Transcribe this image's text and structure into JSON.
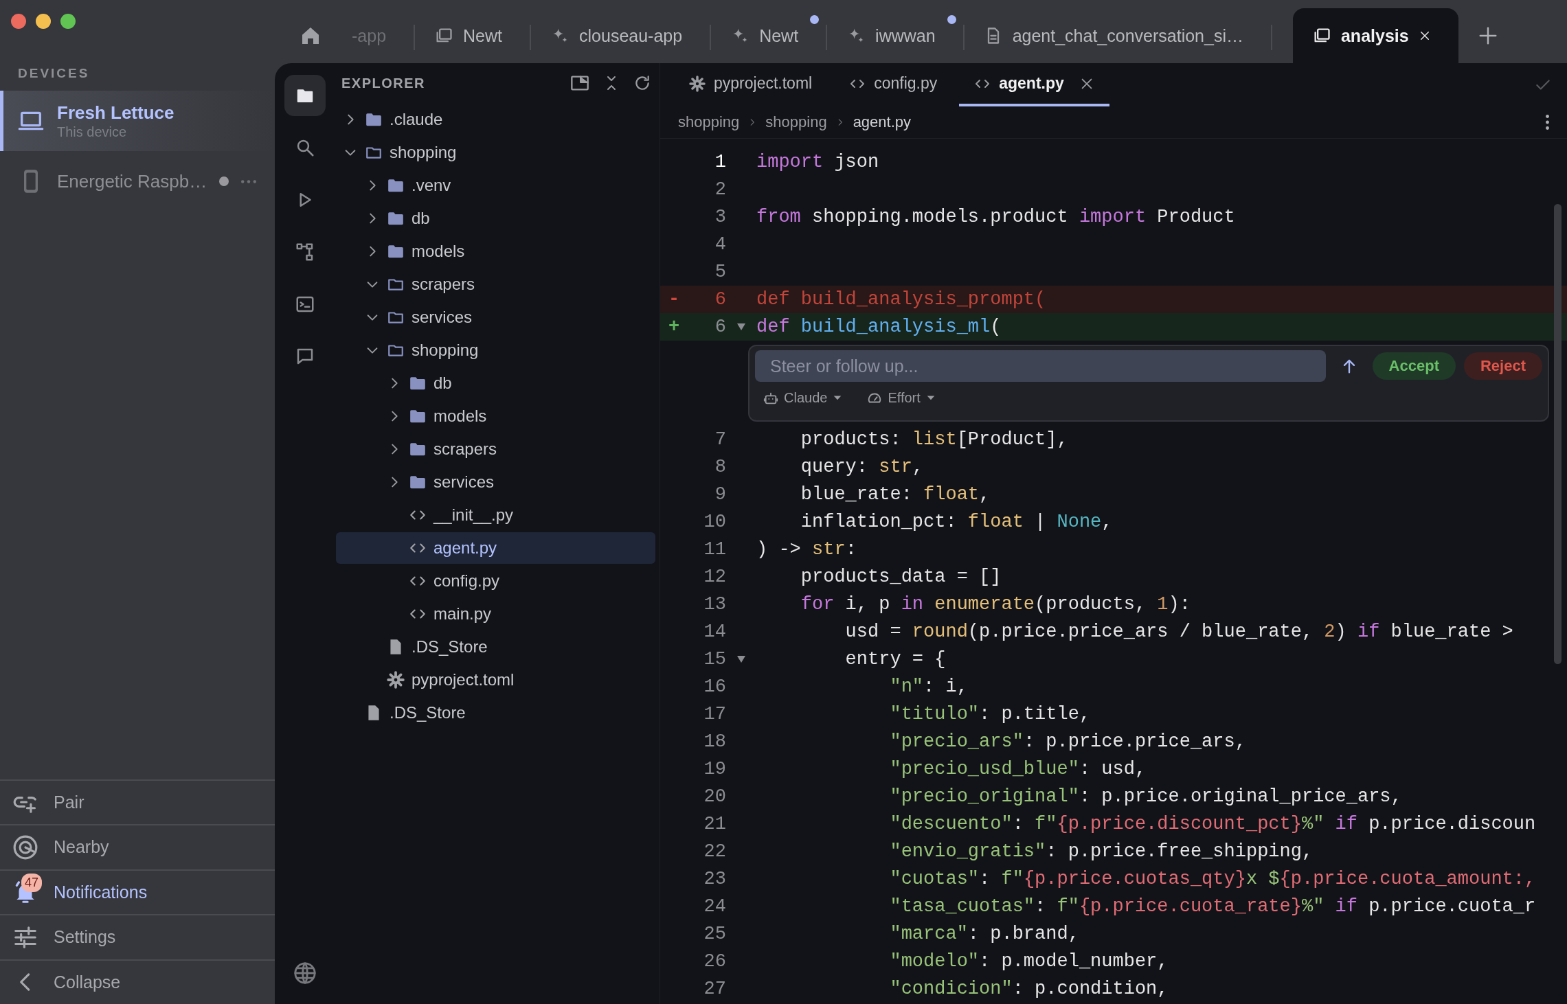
{
  "sidebar": {
    "heading": "DEVICES",
    "devices": [
      {
        "name": "Fresh Lettuce",
        "subtitle": "This device",
        "kind": "laptop",
        "selected": true,
        "status_dot": false
      },
      {
        "name": "Energetic Raspb…",
        "kind": "phone",
        "selected": false,
        "status_dot": true
      }
    ],
    "nav": [
      {
        "label": "Pair",
        "kind": "pair",
        "selected": false
      },
      {
        "label": "Nearby",
        "kind": "nearby",
        "selected": false
      },
      {
        "label": "Notifications",
        "kind": "bell",
        "selected": true,
        "badge": "47"
      },
      {
        "label": "Settings",
        "kind": "settings",
        "selected": false
      },
      {
        "label": "Collapse",
        "kind": "collapse",
        "selected": false
      }
    ]
  },
  "top_tabs": [
    {
      "label": "-app",
      "kind": "clipped",
      "selected": false,
      "unread": false
    },
    {
      "label": "Newt",
      "kind": "folders",
      "selected": false,
      "unread": false
    },
    {
      "label": "clouseau-app",
      "kind": "sparkle",
      "selected": false,
      "unread": false
    },
    {
      "label": "Newt",
      "kind": "sparkle",
      "selected": false,
      "unread": true
    },
    {
      "label": "iwwwan",
      "kind": "sparkle",
      "selected": false,
      "unread": true
    },
    {
      "label": "agent_chat_conversation_si…",
      "kind": "doc",
      "selected": false,
      "unread": false
    },
    {
      "label": "analysis",
      "kind": "folders",
      "selected": true,
      "unread": false
    }
  ],
  "activity_bar": [
    {
      "kind": "files",
      "selected": true
    },
    {
      "kind": "search",
      "selected": false
    },
    {
      "kind": "run",
      "selected": false
    },
    {
      "kind": "diagram",
      "selected": false
    },
    {
      "kind": "terminal",
      "selected": false
    },
    {
      "kind": "chat",
      "selected": false
    }
  ],
  "explorer": {
    "title": "EXPLORER",
    "tree": [
      {
        "name": ".claude",
        "kind": "folder",
        "expanded": false,
        "selected": false
      },
      {
        "name": "shopping",
        "kind": "folder",
        "expanded": true,
        "selected": false,
        "children": [
          {
            "name": ".venv",
            "kind": "folder",
            "expanded": false,
            "selected": false
          },
          {
            "name": "db",
            "kind": "folder",
            "expanded": false,
            "selected": false
          },
          {
            "name": "models",
            "kind": "folder",
            "expanded": false,
            "selected": false
          },
          {
            "name": "scrapers",
            "kind": "folder",
            "expanded": true,
            "selected": false
          },
          {
            "name": "services",
            "kind": "folder",
            "expanded": true,
            "selected": false
          },
          {
            "name": "shopping",
            "kind": "folder",
            "expanded": true,
            "selected": false,
            "children": [
              {
                "name": "db",
                "kind": "folder",
                "expanded": false,
                "selected": false
              },
              {
                "name": "models",
                "kind": "folder",
                "expanded": false,
                "selected": false
              },
              {
                "name": "scrapers",
                "kind": "folder",
                "expanded": false,
                "selected": false
              },
              {
                "name": "services",
                "kind": "folder",
                "expanded": false,
                "selected": false
              },
              {
                "name": "__init__.py",
                "kind": "code",
                "selected": false
              },
              {
                "name": "agent.py",
                "kind": "code",
                "selected": true
              },
              {
                "name": "config.py",
                "kind": "code",
                "selected": false
              },
              {
                "name": "main.py",
                "kind": "code",
                "selected": false
              }
            ]
          },
          {
            "name": ".DS_Store",
            "kind": "file",
            "selected": false
          },
          {
            "name": "pyproject.toml",
            "kind": "config",
            "selected": false
          }
        ]
      },
      {
        "name": ".DS_Store",
        "kind": "file",
        "selected": false
      }
    ]
  },
  "editor": {
    "tabs": [
      {
        "label": "pyproject.toml",
        "kind": "config",
        "selected": false
      },
      {
        "label": "config.py",
        "kind": "code",
        "selected": false
      },
      {
        "label": "agent.py",
        "kind": "code",
        "selected": true
      }
    ],
    "breadcrumb": [
      "shopping",
      "shopping",
      "agent.py"
    ],
    "lines_before": [
      {
        "n": "1",
        "kind": "context",
        "current": true,
        "fold": false,
        "tokens": [
          {
            "kind": "keyword",
            "text": "import"
          },
          {
            "kind": "plain",
            "text": " json"
          }
        ]
      },
      {
        "n": "2",
        "kind": "context",
        "current": false,
        "fold": false
      },
      {
        "n": "3",
        "kind": "context",
        "current": false,
        "fold": false,
        "tokens": [
          {
            "kind": "keyword",
            "text": "from"
          },
          {
            "kind": "plain",
            "text": " shopping.models.product "
          },
          {
            "kind": "keyword",
            "text": "import"
          },
          {
            "kind": "plain",
            "text": " Product"
          }
        ]
      },
      {
        "n": "4",
        "kind": "context",
        "current": false,
        "fold": false
      },
      {
        "n": "5",
        "kind": "context",
        "current": false,
        "fold": false
      },
      {
        "n": "6",
        "kind": "removed",
        "sign": "-",
        "current": false,
        "fold": false,
        "tokens": [
          {
            "kind": "keyword",
            "text": "def"
          },
          {
            "kind": "plain",
            "text": " build_analysis_prompt("
          }
        ]
      },
      {
        "n": "6",
        "kind": "added",
        "sign": "+",
        "current": false,
        "fold": true,
        "tokens": [
          {
            "kind": "keyword",
            "text": "def "
          },
          {
            "kind": "function",
            "text": "build_analysis_ml"
          },
          {
            "kind": "plain",
            "text": "("
          }
        ]
      }
    ],
    "inline_prompt": {
      "placeholder": "Steer or follow up...",
      "buttons": [
        {
          "label": "Accept",
          "kind": "accept"
        },
        {
          "label": "Reject",
          "kind": "reject"
        }
      ],
      "model": "Claude",
      "effort": "Effort"
    },
    "lines_after": [
      {
        "n": "7",
        "kind": "context",
        "current": false,
        "fold": false,
        "tokens": [
          {
            "kind": "plain",
            "text": "    products: "
          },
          {
            "kind": "type",
            "text": "list"
          },
          {
            "kind": "plain",
            "text": "[Product],"
          }
        ]
      },
      {
        "n": "8",
        "kind": "context",
        "current": false,
        "fold": false,
        "tokens": [
          {
            "kind": "plain",
            "text": "    query: "
          },
          {
            "kind": "type",
            "text": "str"
          },
          {
            "kind": "plain",
            "text": ","
          }
        ]
      },
      {
        "n": "9",
        "kind": "context",
        "current": false,
        "fold": false,
        "tokens": [
          {
            "kind": "plain",
            "text": "    blue_rate: "
          },
          {
            "kind": "type",
            "text": "float"
          },
          {
            "kind": "plain",
            "text": ","
          }
        ]
      },
      {
        "n": "10",
        "kind": "context",
        "current": false,
        "fold": false,
        "tokens": [
          {
            "kind": "plain",
            "text": "    inflation_pct: "
          },
          {
            "kind": "type",
            "text": "float"
          },
          {
            "kind": "plain",
            "text": " | "
          },
          {
            "kind": "constant",
            "text": "None"
          },
          {
            "kind": "plain",
            "text": ","
          }
        ]
      },
      {
        "n": "11",
        "kind": "context",
        "current": false,
        "fold": false,
        "tokens": [
          {
            "kind": "plain",
            "text": ") -> "
          },
          {
            "kind": "type",
            "text": "str"
          },
          {
            "kind": "plain",
            "text": ":"
          }
        ]
      },
      {
        "n": "12",
        "kind": "context",
        "current": false,
        "fold": false,
        "tokens": [
          {
            "kind": "plain",
            "text": "    products_data = []"
          }
        ]
      },
      {
        "n": "13",
        "kind": "context",
        "current": false,
        "fold": false,
        "tokens": [
          {
            "kind": "keyword",
            "text": "    for"
          },
          {
            "kind": "plain",
            "text": " i, p "
          },
          {
            "kind": "keyword",
            "text": "in "
          },
          {
            "kind": "type",
            "text": "enumerate"
          },
          {
            "kind": "plain",
            "text": "(products, "
          },
          {
            "kind": "number",
            "text": "1"
          },
          {
            "kind": "plain",
            "text": "):"
          }
        ]
      },
      {
        "n": "14",
        "kind": "context",
        "current": false,
        "fold": false,
        "tokens": [
          {
            "kind": "plain",
            "text": "        usd = "
          },
          {
            "kind": "type",
            "text": "round"
          },
          {
            "kind": "plain",
            "text": "(p.price.price_ars / blue_rate, "
          },
          {
            "kind": "number",
            "text": "2"
          },
          {
            "kind": "plain",
            "text": ") "
          },
          {
            "kind": "keyword",
            "text": "if"
          },
          {
            "kind": "plain",
            "text": " blue_rate >"
          }
        ]
      },
      {
        "n": "15",
        "kind": "context",
        "current": false,
        "fold": true,
        "tokens": [
          {
            "kind": "plain",
            "text": "        entry = {"
          }
        ]
      },
      {
        "n": "16",
        "kind": "context",
        "current": false,
        "fold": false,
        "tokens": [
          {
            "kind": "string",
            "text": "            \"n\""
          },
          {
            "kind": "plain",
            "text": ": i,"
          }
        ]
      },
      {
        "n": "17",
        "kind": "context",
        "current": false,
        "fold": false,
        "tokens": [
          {
            "kind": "string",
            "text": "            \"titulo\""
          },
          {
            "kind": "plain",
            "text": ": p.title,"
          }
        ]
      },
      {
        "n": "18",
        "kind": "context",
        "current": false,
        "fold": false,
        "tokens": [
          {
            "kind": "string",
            "text": "            \"precio_ars\""
          },
          {
            "kind": "plain",
            "text": ": p.price.price_ars,"
          }
        ]
      },
      {
        "n": "19",
        "kind": "context",
        "current": false,
        "fold": false,
        "tokens": [
          {
            "kind": "string",
            "text": "            \"precio_usd_blue\""
          },
          {
            "kind": "plain",
            "text": ": usd,"
          }
        ]
      },
      {
        "n": "20",
        "kind": "context",
        "current": false,
        "fold": false,
        "tokens": [
          {
            "kind": "string",
            "text": "            \"precio_original\""
          },
          {
            "kind": "plain",
            "text": ": p.price.original_price_ars,"
          }
        ]
      },
      {
        "n": "21",
        "kind": "context",
        "current": false,
        "fold": false,
        "tokens": [
          {
            "kind": "string",
            "text": "            \"descuento\""
          },
          {
            "kind": "plain",
            "text": ": "
          },
          {
            "kind": "string",
            "text": "f\""
          },
          {
            "kind": "interp",
            "text": "{p.price.discount_pct}"
          },
          {
            "kind": "string",
            "text": "%\""
          },
          {
            "kind": "keyword",
            "text": " if"
          },
          {
            "kind": "plain",
            "text": " p.price.discoun"
          }
        ]
      },
      {
        "n": "22",
        "kind": "context",
        "current": false,
        "fold": false,
        "tokens": [
          {
            "kind": "string",
            "text": "            \"envio_gratis\""
          },
          {
            "kind": "plain",
            "text": ": p.price.free_shipping,"
          }
        ]
      },
      {
        "n": "23",
        "kind": "context",
        "current": false,
        "fold": false,
        "tokens": [
          {
            "kind": "string",
            "text": "            \"cuotas\""
          },
          {
            "kind": "plain",
            "text": ": "
          },
          {
            "kind": "string",
            "text": "f\""
          },
          {
            "kind": "interp",
            "text": "{p.price.cuotas_qty}"
          },
          {
            "kind": "string",
            "text": "x $"
          },
          {
            "kind": "interp",
            "text": "{p.price.cuota_amount:,"
          }
        ]
      },
      {
        "n": "24",
        "kind": "context",
        "current": false,
        "fold": false,
        "tokens": [
          {
            "kind": "string",
            "text": "            \"tasa_cuotas\""
          },
          {
            "kind": "plain",
            "text": ": "
          },
          {
            "kind": "string",
            "text": "f\""
          },
          {
            "kind": "interp",
            "text": "{p.price.cuota_rate}"
          },
          {
            "kind": "string",
            "text": "%\""
          },
          {
            "kind": "keyword",
            "text": " if"
          },
          {
            "kind": "plain",
            "text": " p.price.cuota_r"
          }
        ]
      },
      {
        "n": "25",
        "kind": "context",
        "current": false,
        "fold": false,
        "tokens": [
          {
            "kind": "string",
            "text": "            \"marca\""
          },
          {
            "kind": "plain",
            "text": ": p.brand,"
          }
        ]
      },
      {
        "n": "26",
        "kind": "context",
        "current": false,
        "fold": false,
        "tokens": [
          {
            "kind": "string",
            "text": "            \"modelo\""
          },
          {
            "kind": "plain",
            "text": ": p.model_number,"
          }
        ]
      },
      {
        "n": "27",
        "kind": "context",
        "current": false,
        "fold": false,
        "tokens": [
          {
            "kind": "string",
            "text": "            \"condicion\""
          },
          {
            "kind": "plain",
            "text": ": p.condition,"
          }
        ]
      }
    ]
  }
}
